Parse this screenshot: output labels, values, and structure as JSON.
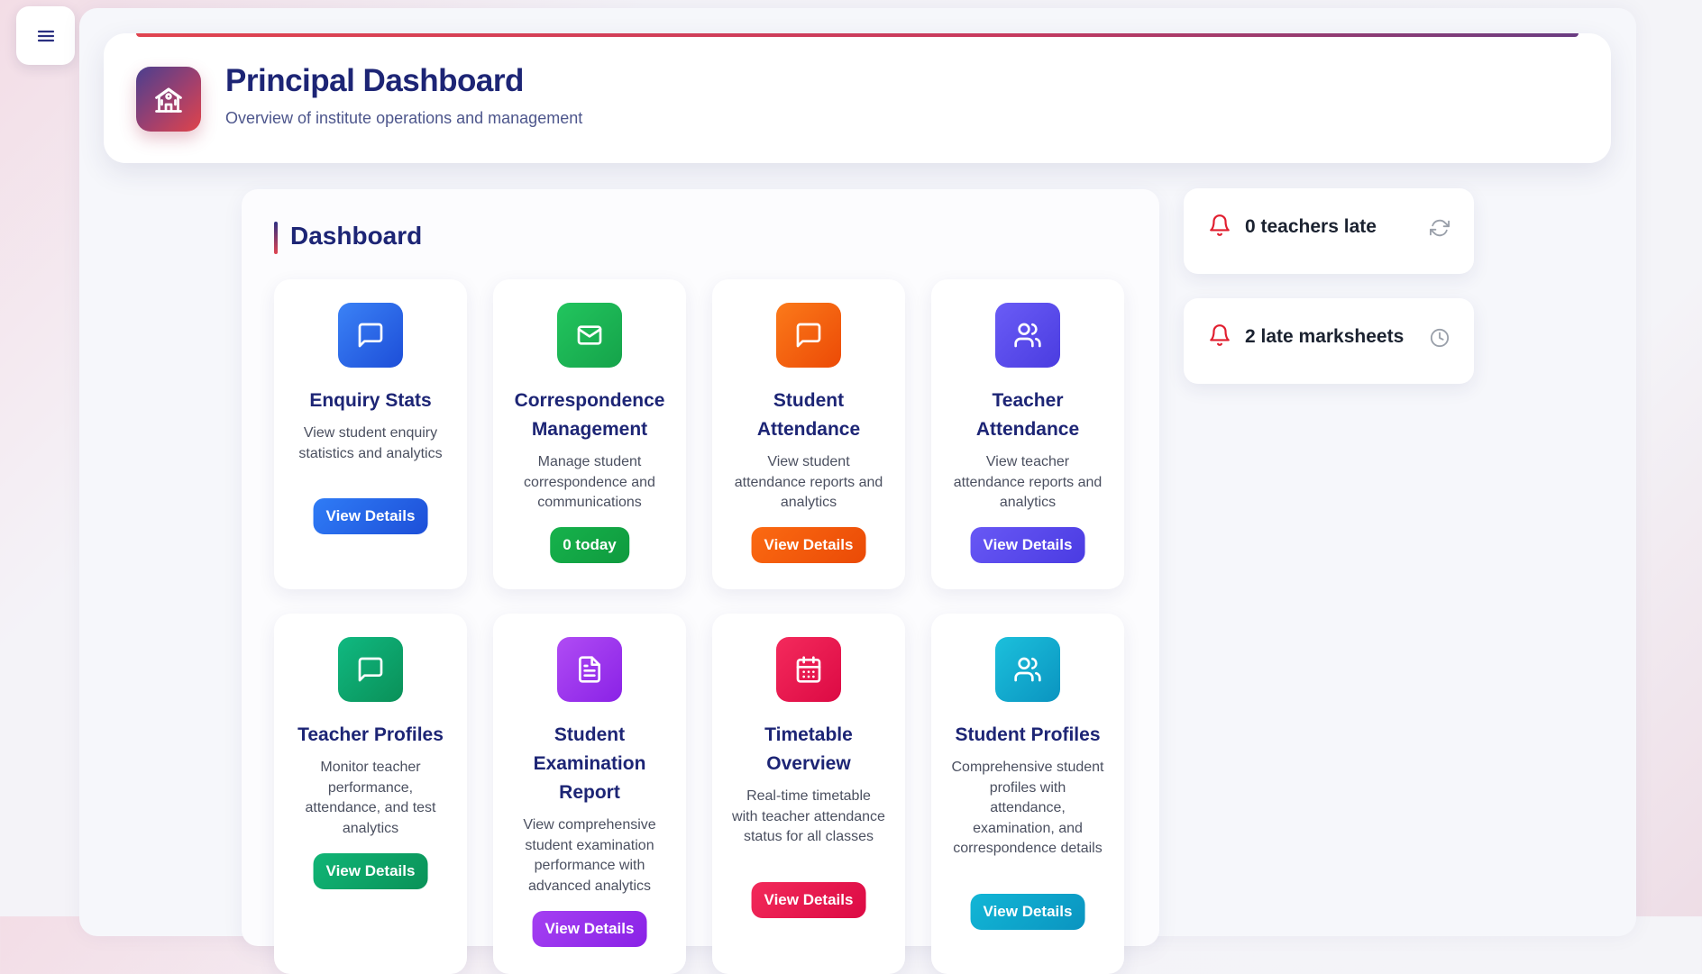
{
  "nav": {
    "menu_icon": "hamburger-menu-icon"
  },
  "header": {
    "icon": "school-building-icon",
    "title": "Principal Dashboard",
    "subtitle": "Overview of institute operations and management"
  },
  "dashboard": {
    "section_title": "Dashboard",
    "cards": [
      {
        "title": "Enquiry Stats",
        "description": "View student enquiry statistics and analytics",
        "button": "View Details",
        "icon": "message-square-icon",
        "color": "#2563eb"
      },
      {
        "title": "Correspondence Management",
        "description": "Manage student correspondence and communications",
        "button": "0 today",
        "icon": "mail-icon",
        "color": "#16a34a"
      },
      {
        "title": "Student Attendance",
        "description": "View student attendance reports and analytics",
        "button": "View Details",
        "icon": "message-square-icon",
        "color": "#f55a0a"
      },
      {
        "title": "Teacher Attendance",
        "description": "View teacher attendance reports and analytics",
        "button": "View Details",
        "icon": "users-icon",
        "color": "#5b4cf0"
      },
      {
        "title": "Teacher Profiles",
        "description": "Monitor teacher performance, attendance, and test analytics",
        "button": "View Details",
        "icon": "message-square-icon",
        "color": "#0ea06a"
      },
      {
        "title": "Student Examination Report",
        "description": "View comprehensive student examination performance with advanced analytics",
        "button": "View Details",
        "icon": "file-text-icon",
        "color": "#9333ea"
      },
      {
        "title": "Timetable Overview",
        "description": "Real-time timetable with teacher attendance status for all classes",
        "button": "View Details",
        "icon": "calendar-icon",
        "color": "#e8124e"
      },
      {
        "title": "Student Profiles",
        "description": "Comprehensive student profiles with attendance, examination, and correspondence details",
        "button": "View Details",
        "icon": "users-icon",
        "color": "#0aa6c9"
      }
    ]
  },
  "alerts": [
    {
      "text": "0 teachers late",
      "icon": "bell-icon",
      "action_icon": "refresh-icon"
    },
    {
      "text": "2 late marksheets",
      "icon": "bell-icon",
      "action_icon": "clock-icon"
    }
  ]
}
